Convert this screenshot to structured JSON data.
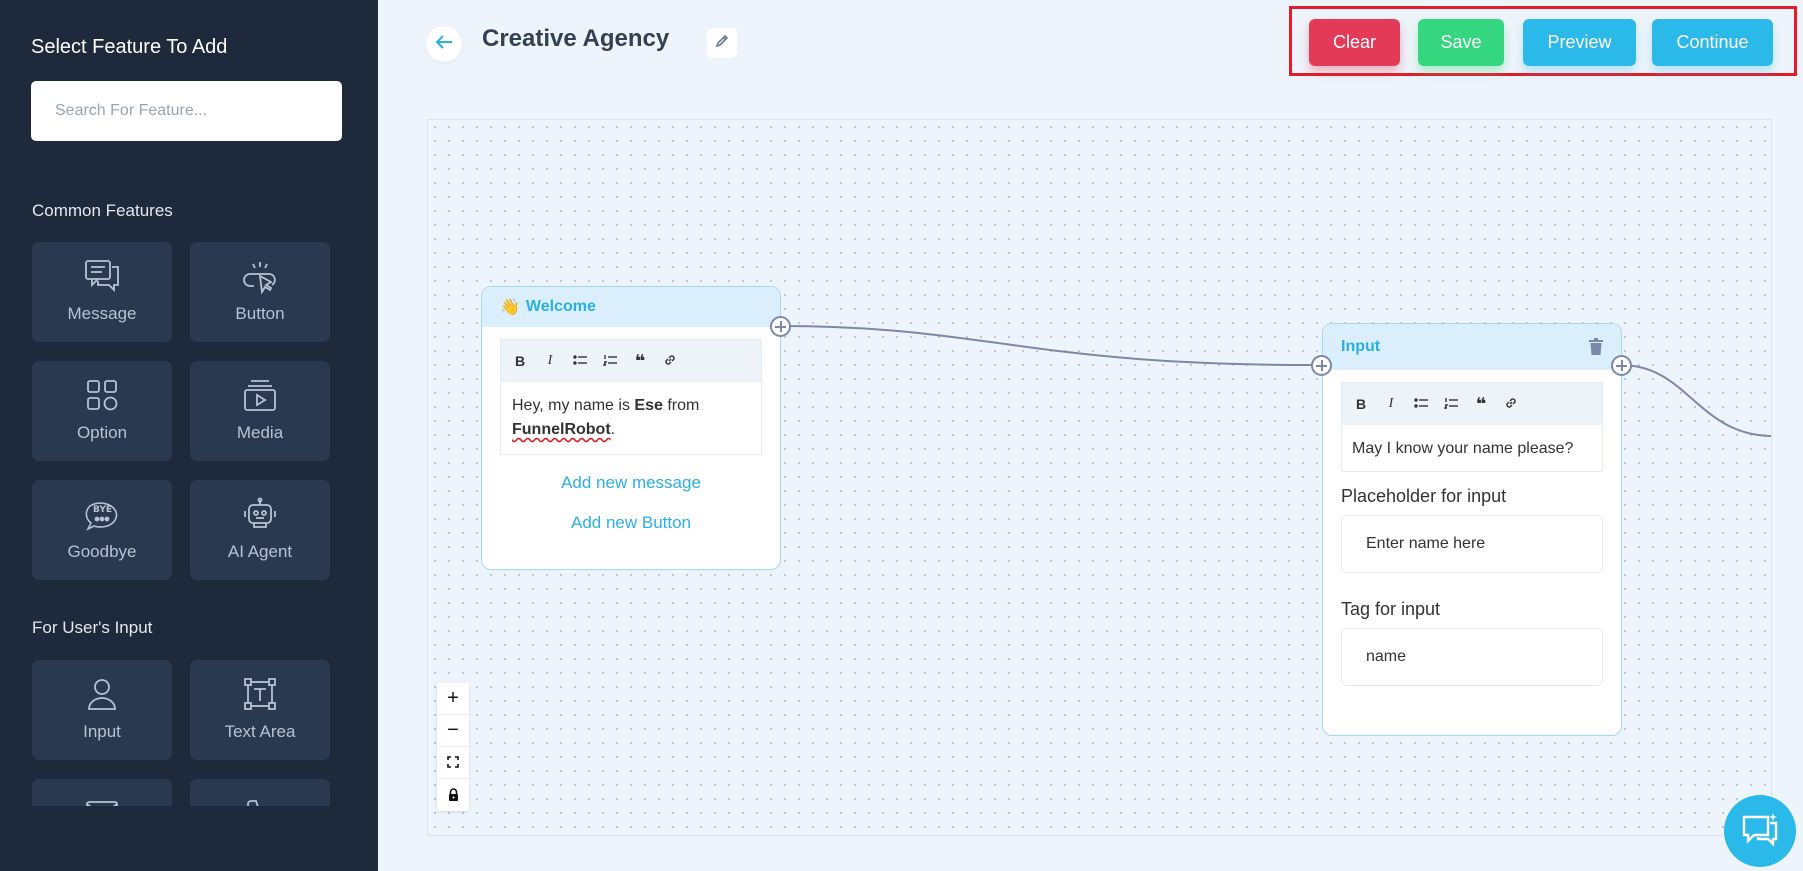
{
  "sidebar": {
    "title": "Select Feature To Add",
    "search_placeholder": "Search For Feature...",
    "section_common": "Common Features",
    "section_input": "For User's Input",
    "common": [
      "Message",
      "Button",
      "Option",
      "Media",
      "Goodbye",
      "AI Agent"
    ],
    "user_input": [
      "Input",
      "Text Area"
    ]
  },
  "header": {
    "title": "Creative Agency",
    "clear": "Clear",
    "save": "Save",
    "preview": "Preview",
    "continue": "Continue"
  },
  "welcome_node": {
    "title": "Welcome",
    "emoji": "👋",
    "msg_pre": "Hey, my name is ",
    "msg_bold": "Ese",
    "msg_mid": " from",
    "msg_brand": "FunnelRobot",
    "msg_end": ".",
    "add_message": "Add new message",
    "add_button": "Add new Button"
  },
  "input_node": {
    "title": "Input",
    "message": "May I know your name please?",
    "placeholder_label": "Placeholder for input",
    "placeholder_value": "Enter name here",
    "tag_label": "Tag for input",
    "tag_value": "name"
  },
  "toolbar": {
    "bold": "B",
    "italic": "I"
  },
  "colors": {
    "sidebar": "#1e293b",
    "accent": "#2bb9ea",
    "clear": "#e23a57",
    "save": "#34d77f"
  }
}
